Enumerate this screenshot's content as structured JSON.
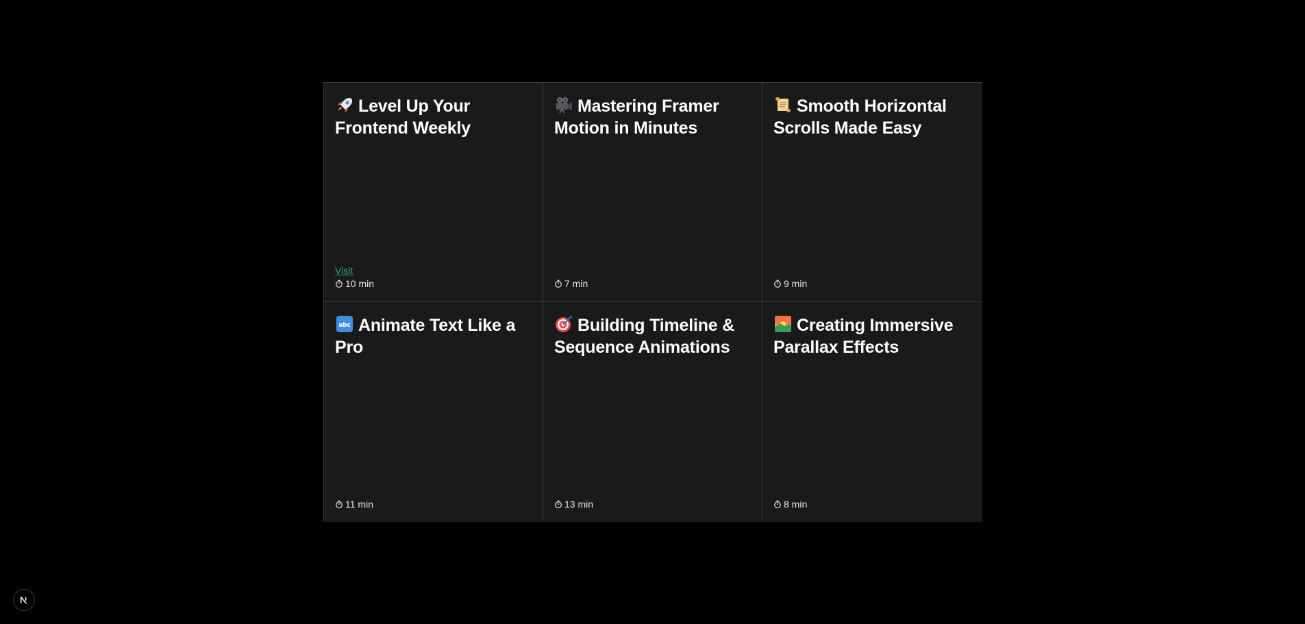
{
  "cards": [
    {
      "icon": "rocket-icon",
      "title": "Level Up Your Frontend Weekly",
      "link_label": "Visit",
      "duration": "10 min"
    },
    {
      "icon": "film-camera-icon",
      "title": "Mastering Framer Motion in Minutes",
      "duration": "7 min"
    },
    {
      "icon": "scroll-icon",
      "title": "Smooth Horizontal Scrolls Made Easy",
      "duration": "9 min"
    },
    {
      "icon": "abc-icon",
      "title": "Animate Text Like a Pro",
      "duration": "11 min"
    },
    {
      "icon": "target-icon",
      "title": "Building Timeline & Sequence Animations",
      "duration": "13 min"
    },
    {
      "icon": "sunrise-icon",
      "title": "Creating Immersive Parallax Effects",
      "duration": "8 min"
    }
  ],
  "footer": {
    "logo_letter": "N",
    "logo_icon": "nextjs-logo-icon"
  },
  "colors": {
    "background": "#000000",
    "card": "#1a1a1a",
    "border": "#3a3a3a",
    "link": "#2ea77a"
  }
}
